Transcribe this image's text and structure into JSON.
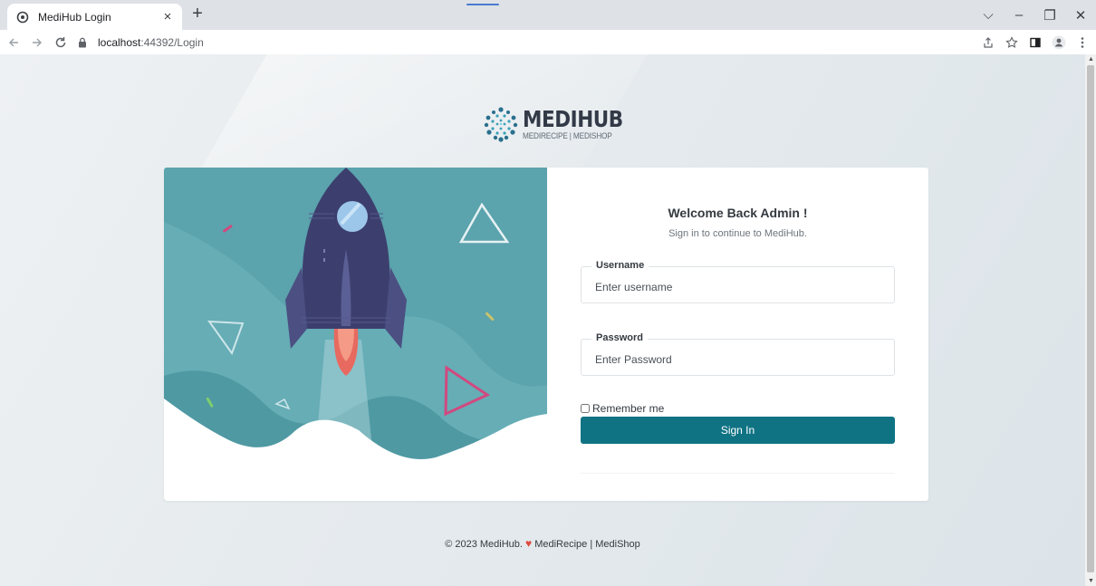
{
  "browser": {
    "tab_title": "MediHub Login",
    "tab_close": "×",
    "new_tab": "+",
    "url_host": "localhost",
    "url_path": ":44392/Login",
    "window_controls": {
      "dropdown": "⌵",
      "minimize": "–",
      "restore": "❐",
      "close": "✕"
    }
  },
  "logo": {
    "brand": "MEDIHUB",
    "tagline": "MEDIRECIPE | MEDISHOP"
  },
  "login": {
    "welcome": "Welcome Back Admin !",
    "subtitle": "Sign in to continue to MediHub.",
    "username_label": "Username",
    "username_placeholder": "Enter username",
    "password_label": "Password",
    "password_placeholder": "Enter Password",
    "remember_label": "Remember me",
    "sign_in": "Sign In"
  },
  "footer": {
    "copyright": "© 2023 MediHub.",
    "heart": "♥",
    "links": "MediRecipe | MediShop"
  },
  "colors": {
    "primary": "#0f7384",
    "illustration_teal": "#5ba3ad",
    "rocket_body": "#3c3f6e",
    "heart": "#e0493f"
  }
}
